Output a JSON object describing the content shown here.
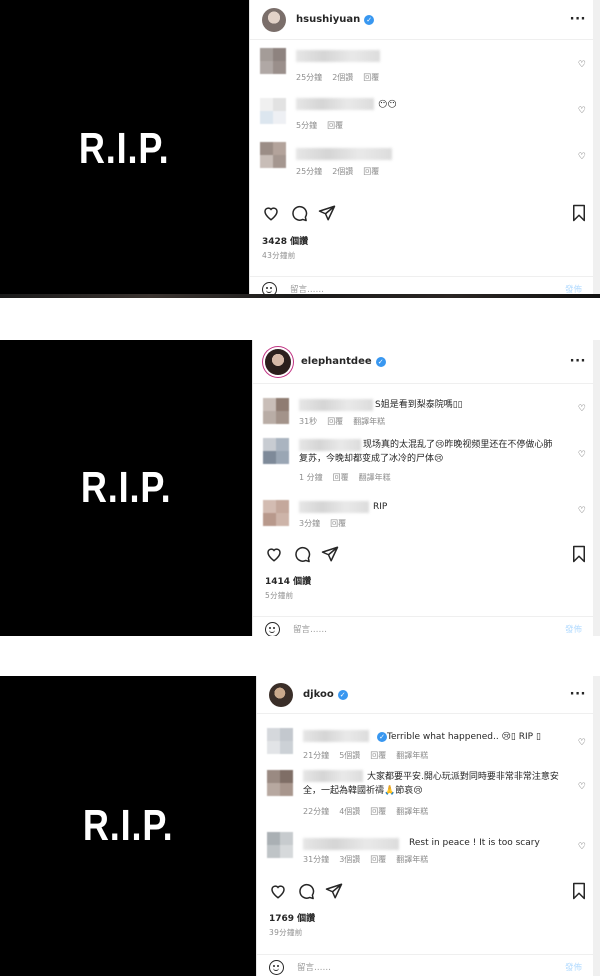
{
  "posts": [
    {
      "image_text": "R.I.P.",
      "username": "hsushiyuan",
      "comments": [
        {
          "text": "",
          "trail": "",
          "meta": [
            "25分鐘",
            "2個讚",
            "回覆"
          ]
        },
        {
          "text": "",
          "trail": "😶😶",
          "meta": [
            "5分鐘",
            "回覆"
          ]
        },
        {
          "text": "",
          "trail": "",
          "meta": [
            "25分鐘",
            "2個讚",
            "回覆"
          ]
        }
      ],
      "likes": "3428 個讚",
      "time_ago": "43分鐘前",
      "comment_placeholder": "留言……",
      "post_label": "發佈"
    },
    {
      "image_text": "R.I.P.",
      "username": "elephantdee",
      "comments": [
        {
          "text": "S姐是看到梨泰院嗎▯▯",
          "meta": [
            "31秒",
            "回覆",
            "翻譯年糕"
          ]
        },
        {
          "text": "现场真的太混乱了😢昨晚视频里还在不停做心肺",
          "text2": "复苏，今晚却都变成了冰冷的尸体😢",
          "meta": [
            "1 分鐘",
            "回覆",
            "翻譯年糕"
          ]
        },
        {
          "text": "RIP",
          "meta": [
            "3分鐘",
            "回覆"
          ]
        }
      ],
      "likes": "1414 個讚",
      "time_ago": "5分鐘前",
      "comment_placeholder": "留言……",
      "post_label": "發佈"
    },
    {
      "image_text": "R.I.P.",
      "username": "djkoo",
      "comments": [
        {
          "text": "Terrible what happened.. 😢▯ RIP ▯",
          "meta": [
            "21分鐘",
            "5個讚",
            "回覆",
            "翻譯年糕"
          ]
        },
        {
          "text": "大家都要平安.開心玩派對同時要非常非常注意安",
          "text2": "全，一起為韓國祈禱🙏節哀😢",
          "meta": [
            "22分鐘",
            "4個讚",
            "回覆",
            "翻譯年糕"
          ]
        },
        {
          "text": "Rest in peace ! It is too scary",
          "meta": [
            "31分鐘",
            "3個讚",
            "回覆",
            "翻譯年糕"
          ]
        }
      ],
      "likes": "1769 個讚",
      "time_ago": "39分鐘前",
      "comment_placeholder": "留言……",
      "post_label": "發佈"
    }
  ],
  "colors": {
    "image_bg": "#000000",
    "verified": "#3897f0",
    "post_button": "#b3dbff"
  },
  "icons": [
    "heart-icon",
    "comment-icon",
    "share-icon",
    "bookmark-icon",
    "more-icon",
    "emoji-icon",
    "verified-icon"
  ]
}
